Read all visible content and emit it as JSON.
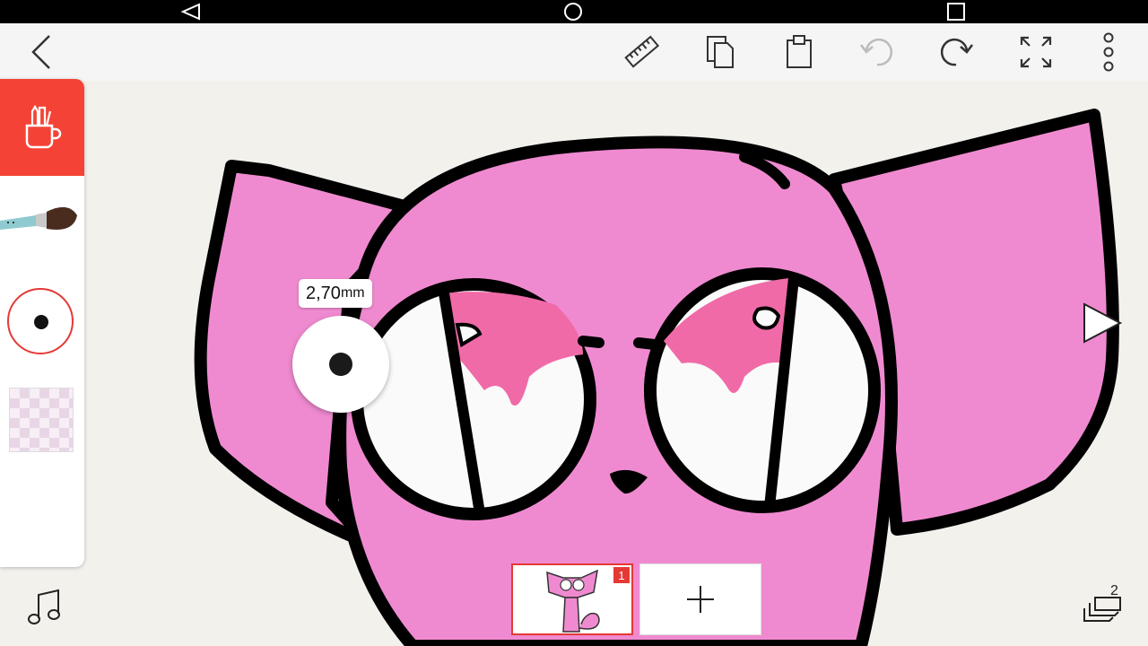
{
  "system_nav": {
    "icons": [
      "back-triangle-icon",
      "home-circle-icon",
      "recents-square-icon"
    ]
  },
  "toolbar": {
    "icons": [
      "back-chevron-icon",
      "ruler-icon",
      "copy-icon",
      "paste-icon",
      "undo-icon",
      "redo-icon",
      "fullscreen-icon",
      "more-vertical-icon"
    ]
  },
  "left_panel": {
    "tools_icon": "pencil-cup-icon",
    "brush_icon": "paintbrush-icon",
    "accent_color": "#f44336"
  },
  "brush_size": {
    "value": "2,70",
    "unit": "mm"
  },
  "timeline": {
    "frames": [
      {
        "number": "1"
      }
    ],
    "add_icon": "plus-icon"
  },
  "bottom": {
    "music_icon": "music-note-icon",
    "layers_icon": "layers-icon",
    "layers_count": "2"
  },
  "drawing": {
    "fill_color": "#f08ad0",
    "iris_color": "#f06aa8",
    "outline_color": "#000000"
  }
}
